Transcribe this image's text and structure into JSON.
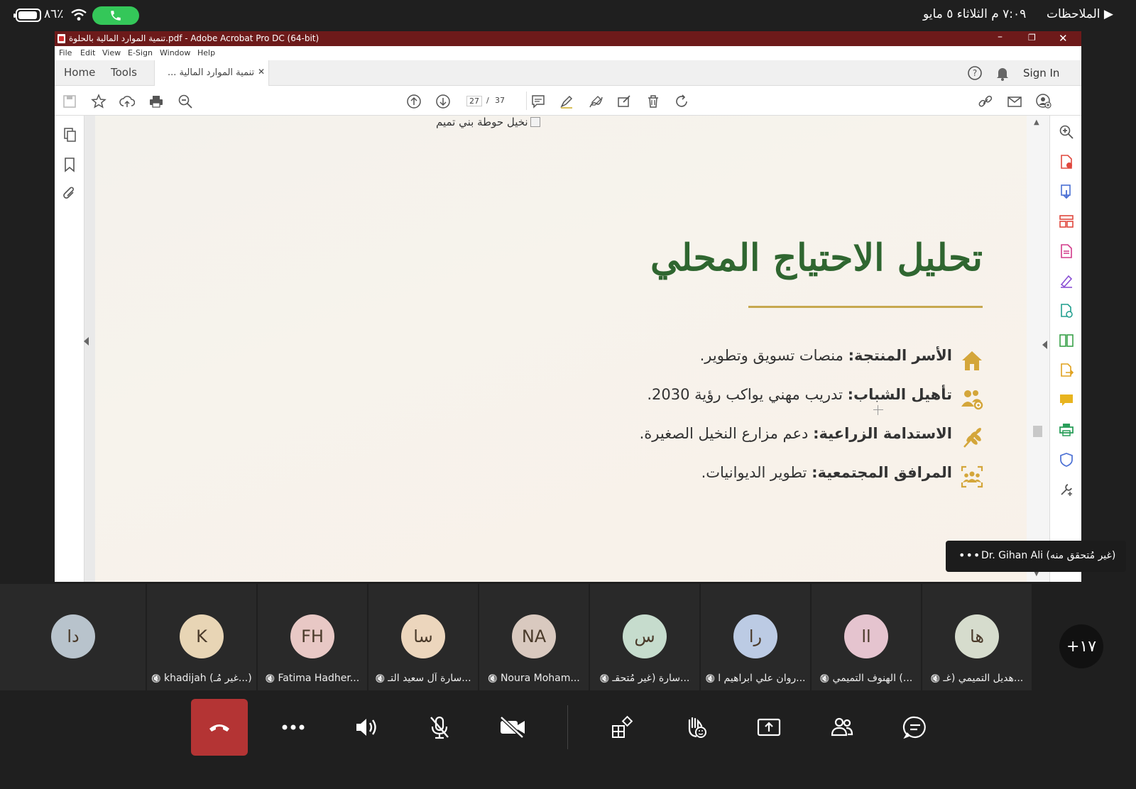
{
  "status_bar": {
    "app_back": "▶ الملاحظات",
    "datetime": "٧:٠٩ م  الثلاثاء ٥ مايو",
    "battery": "٨٦٪"
  },
  "acrobat": {
    "window_title": "تنمية الموارد المالية بالحلوة.pdf - Adobe Acrobat Pro DC (64-bit)",
    "menu": [
      "File",
      "Edit",
      "View",
      "E-Sign",
      "Window",
      "Help"
    ],
    "tabs": {
      "home": "Home",
      "tools": "Tools",
      "doc_tab": "تنمية الموارد المالية ..."
    },
    "sign_in": "Sign In",
    "page_current": "27",
    "page_sep": "/",
    "page_total": "37"
  },
  "slide": {
    "broken_image_alt": "نخيل حوطة بني تميم",
    "title": "تحليل الاحتياج المحلي",
    "bullets": [
      {
        "label": "الأسر المنتجة:",
        "text": " منصات تسويق وتطوير.",
        "icon": "house-icon"
      },
      {
        "label": "تأهيل الشباب:",
        "text": " تدريب مهني يواكب رؤية 2030.",
        "icon": "people-gear-icon"
      },
      {
        "label": "الاستدامة الزراعية:",
        "text": " دعم مزارع النخيل الصغيرة.",
        "icon": "wheat-icon"
      },
      {
        "label": "المرافق المجتمعية:",
        "text": " تطوير الديوانيات.",
        "icon": "community-icon"
      }
    ],
    "accent_color": "#2f6630",
    "rule_color": "#c7a84f"
  },
  "presenter_badge": {
    "name": "Dr. Gihan Ali (غير مُتحقق منه)",
    "more": "•••"
  },
  "participants": [
    {
      "initials": "دا",
      "name": "",
      "color": "#b8c3cc",
      "muted": false
    },
    {
      "initials": "K",
      "name": "khadijah  (غير مُـ...)",
      "color": "#e8d5b5",
      "muted": true
    },
    {
      "initials": "FH",
      "name": "Fatima Hadher...",
      "color": "#e8c8c5",
      "muted": true
    },
    {
      "initials": "سا",
      "name": "سارة آل سعيد التـ...",
      "color": "#ecd6bd",
      "muted": true
    },
    {
      "initials": "NA",
      "name": "Noura Moham...",
      "color": "#d9c9bf",
      "muted": true
    },
    {
      "initials": "س",
      "name": "سارة  (غير مُتحقـ...",
      "color": "#c6dccd",
      "muted": true
    },
    {
      "initials": "را",
      "name": "روان علي ابراهيم ا...",
      "color": "#bccbe4",
      "muted": true
    },
    {
      "initials": "اا",
      "name": "الهنوف التميمي (...",
      "color": "#e5c4cf",
      "muted": true
    },
    {
      "initials": "ها",
      "name": "هديل التميمي (غـ...",
      "color": "#d6dccd",
      "muted": true
    }
  ],
  "overflow_count": "+١٧",
  "controls": [
    "end-call",
    "more",
    "speaker",
    "mic-off",
    "camera-off",
    "apps",
    "raise-hand",
    "share",
    "people",
    "chat"
  ]
}
